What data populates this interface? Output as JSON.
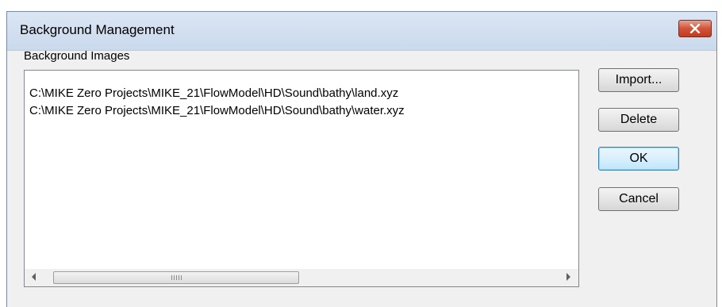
{
  "window": {
    "title": "Background Management",
    "close_icon": "close-x-icon",
    "close_color": "#c9462c"
  },
  "group": {
    "label": "Background Images"
  },
  "list": {
    "items": [
      "C:\\MIKE Zero Projects\\MIKE_21\\FlowModel\\HD\\Sound\\bathy\\land.xyz",
      "C:\\MIKE Zero Projects\\MIKE_21\\FlowModel\\HD\\Sound\\bathy\\water.xyz"
    ]
  },
  "buttons": {
    "import": "Import...",
    "delete": "Delete",
    "ok": "OK",
    "cancel": "Cancel"
  }
}
